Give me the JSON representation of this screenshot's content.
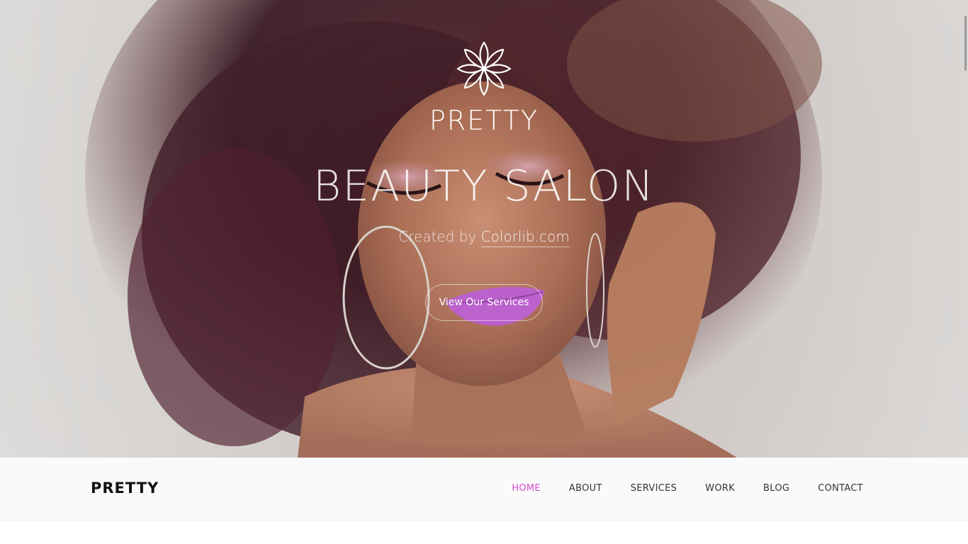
{
  "hero": {
    "brand": "PRETTY",
    "headline": "BEAUTY SALON",
    "credit_prefix": "Created by ",
    "credit_link": "Colorlib.com",
    "cta_label": "View Our Services",
    "logo_icon": "lotus-flower-icon"
  },
  "navbar": {
    "brand": "PRETTY",
    "items": [
      {
        "label": "HOME",
        "active": true
      },
      {
        "label": "ABOUT",
        "active": false
      },
      {
        "label": "SERVICES",
        "active": false
      },
      {
        "label": "WORK",
        "active": false
      },
      {
        "label": "BLOG",
        "active": false
      },
      {
        "label": "CONTACT",
        "active": false
      }
    ]
  },
  "colors": {
    "accent": "#d64fcf",
    "nav_background": "#fafafa",
    "text_dark": "#111111"
  }
}
